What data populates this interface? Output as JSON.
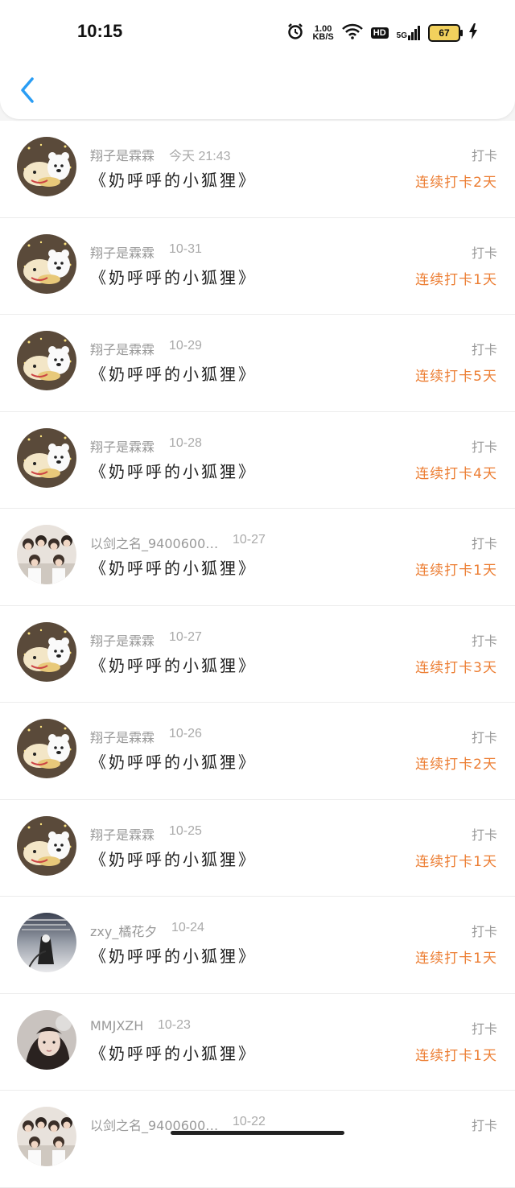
{
  "status_bar": {
    "time": "10:15",
    "net_speed_value": "1.00",
    "net_speed_unit": "KB/S",
    "hd_label": "HD",
    "signal_label": "5G",
    "battery_level": "67"
  },
  "colors": {
    "accent_blue": "#2a9df4",
    "streak_orange": "#ec7d32"
  },
  "items": [
    {
      "name": "翔子是霖霖",
      "date": "今天 21:43",
      "title": "《奶呼呼的小狐狸》",
      "type": "打卡",
      "streak": "连续打卡2天",
      "avatar": "bear-avatar"
    },
    {
      "name": "翔子是霖霖",
      "date": "10-31",
      "title": "《奶呼呼的小狐狸》",
      "type": "打卡",
      "streak": "连续打卡1天",
      "avatar": "bear-avatar"
    },
    {
      "name": "翔子是霖霖",
      "date": "10-29",
      "title": "《奶呼呼的小狐狸》",
      "type": "打卡",
      "streak": "连续打卡5天",
      "avatar": "bear-avatar"
    },
    {
      "name": "翔子是霖霖",
      "date": "10-28",
      "title": "《奶呼呼的小狐狸》",
      "type": "打卡",
      "streak": "连续打卡4天",
      "avatar": "bear-avatar"
    },
    {
      "name": "以剑之名_9400600…",
      "date": "10-27",
      "title": "《奶呼呼的小狐狸》",
      "type": "打卡",
      "streak": "连续打卡1天",
      "avatar": "group-photo-avatar"
    },
    {
      "name": "翔子是霖霖",
      "date": "10-27",
      "title": "《奶呼呼的小狐狸》",
      "type": "打卡",
      "streak": "连续打卡3天",
      "avatar": "bear-avatar"
    },
    {
      "name": "翔子是霖霖",
      "date": "10-26",
      "title": "《奶呼呼的小狐狸》",
      "type": "打卡",
      "streak": "连续打卡2天",
      "avatar": "bear-avatar"
    },
    {
      "name": "翔子是霖霖",
      "date": "10-25",
      "title": "《奶呼呼的小狐狸》",
      "type": "打卡",
      "streak": "连续打卡1天",
      "avatar": "bear-avatar"
    },
    {
      "name": "zxy_橘花夕",
      "date": "10-24",
      "title": "《奶呼呼的小狐狸》",
      "type": "打卡",
      "streak": "连续打卡1天",
      "avatar": "ink-art-avatar"
    },
    {
      "name": "MMJXZH",
      "date": "10-23",
      "title": "《奶呼呼的小狐狸》",
      "type": "打卡",
      "streak": "连续打卡1天",
      "avatar": "girl-photo-avatar"
    },
    {
      "name": "以剑之名_9400600…",
      "date": "10-22",
      "title": "",
      "type": "打卡",
      "streak": "",
      "avatar": "group-photo-avatar"
    }
  ]
}
